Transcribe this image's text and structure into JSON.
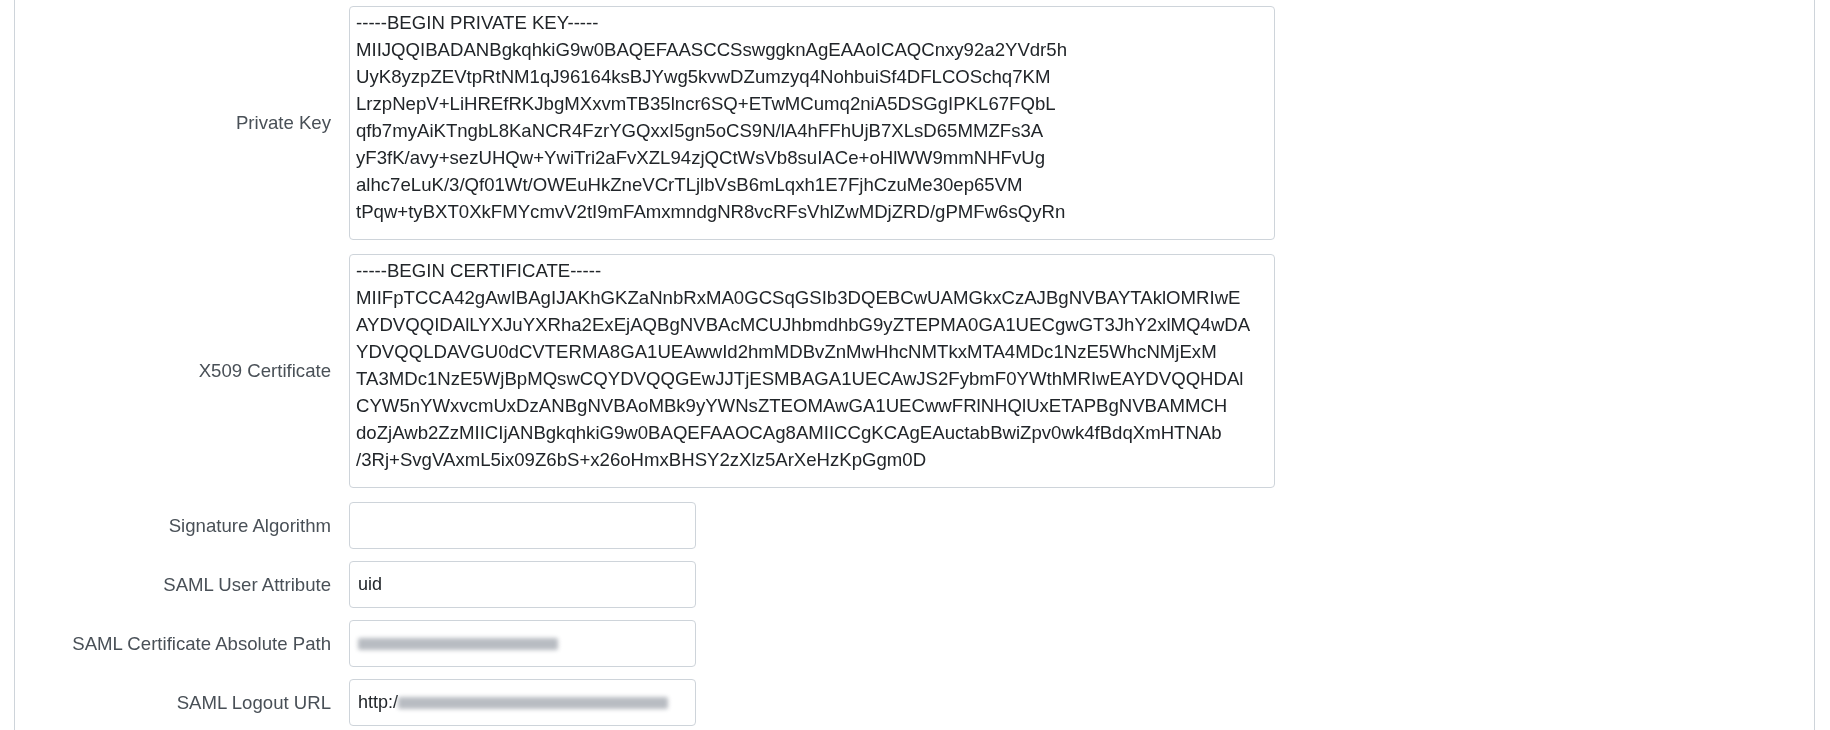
{
  "fields": [
    {
      "kind": "textarea",
      "label": "Private Key",
      "lines": [
        "-----BEGIN PRIVATE KEY-----",
        "MIIJQQIBADANBgkqhkiG9w0BAQEFAASCCSswggknAgEAAoICAQCnxy92a2YVdr5h",
        "UyK8yzpZEVtpRtNM1qJ96164ksBJYwg5kvwDZumzyq4NohbuiSf4DFLCOSchq7KM",
        "LrzpNepV+LiHREfRKJbgMXxvmTB35lncr6SQ+ETwMCumq2niA5DSGgIPKL67FQbL",
        "qfb7myAiKTngbL8KaNCR4FzrYGQxxI5gn5oCS9N/lA4hFFhUjB7XLsD65MMZFs3A",
        "yF3fK/avy+sezUHQw+YwiTri2aFvXZL94zjQCtWsVb8suIACe+oHlWW9mmNHFvUg",
        "alhc7eLuK/3/Qf01Wt/OWEuHkZneVCrTLjlbVsB6mLqxh1E7FjhCzuMe30ep65VM",
        "tPqw+tyBXT0XkFMYcmvV2tI9mFAmxmndgNR8vcRFsVhlZwMDjZRD/gPMFw6sQyRn"
      ]
    },
    {
      "kind": "textarea",
      "label": "X509 Certificate",
      "lines": [
        "-----BEGIN CERTIFICATE-----",
        "MIIFpTCCA42gAwIBAgIJAKhGKZaNnbRxMA0GCSqGSIb3DQEBCwUAMGkxCzAJBgNVBAYTAklOMRIwE",
        "AYDVQQIDAlLYXJuYXRha2ExEjAQBgNVBAcMCUJhbmdhbG9yZTEPMA0GA1UECgwGT3JhY2xlMQ4wDA",
        "YDVQQLDAVGU0dCVTERMA8GA1UEAwwId2hmMDBvZnMwHhcNMTkxMTA4MDc1NzE5WhcNMjExM",
        "TA3MDc1NzE5WjBpMQswCQYDVQQGEwJJTjESMBAGA1UECAwJS2FybmF0YWthMRIwEAYDVQQHDAl",
        "CYW5nYWxvcmUxDzANBgNVBAoMBk9yYWNsZTEOMAwGA1UECwwFRlNHQlUxETAPBgNVBAMMCH",
        "doZjAwb2ZzMIICIjANBgkqhkiG9w0BAQEFAAOCAg8AMIICCgKCAgEAuctabBwiZpv0wk4fBdqXmHTNAb",
        "/3Rj+SvgVAxmL5ix09Z6bS+x26oHmxBHSY2zXlz5ArXeHzKpGgm0D"
      ]
    },
    {
      "kind": "input",
      "label": "Signature Algorithm"
    },
    {
      "kind": "input",
      "label": "SAML User Attribute",
      "value": "uid"
    },
    {
      "kind": "input",
      "label": "SAML Certificate Absolute Path",
      "redacted": true
    },
    {
      "kind": "input",
      "label": "SAML Logout URL",
      "value": "http:/",
      "redacted": true
    }
  ]
}
